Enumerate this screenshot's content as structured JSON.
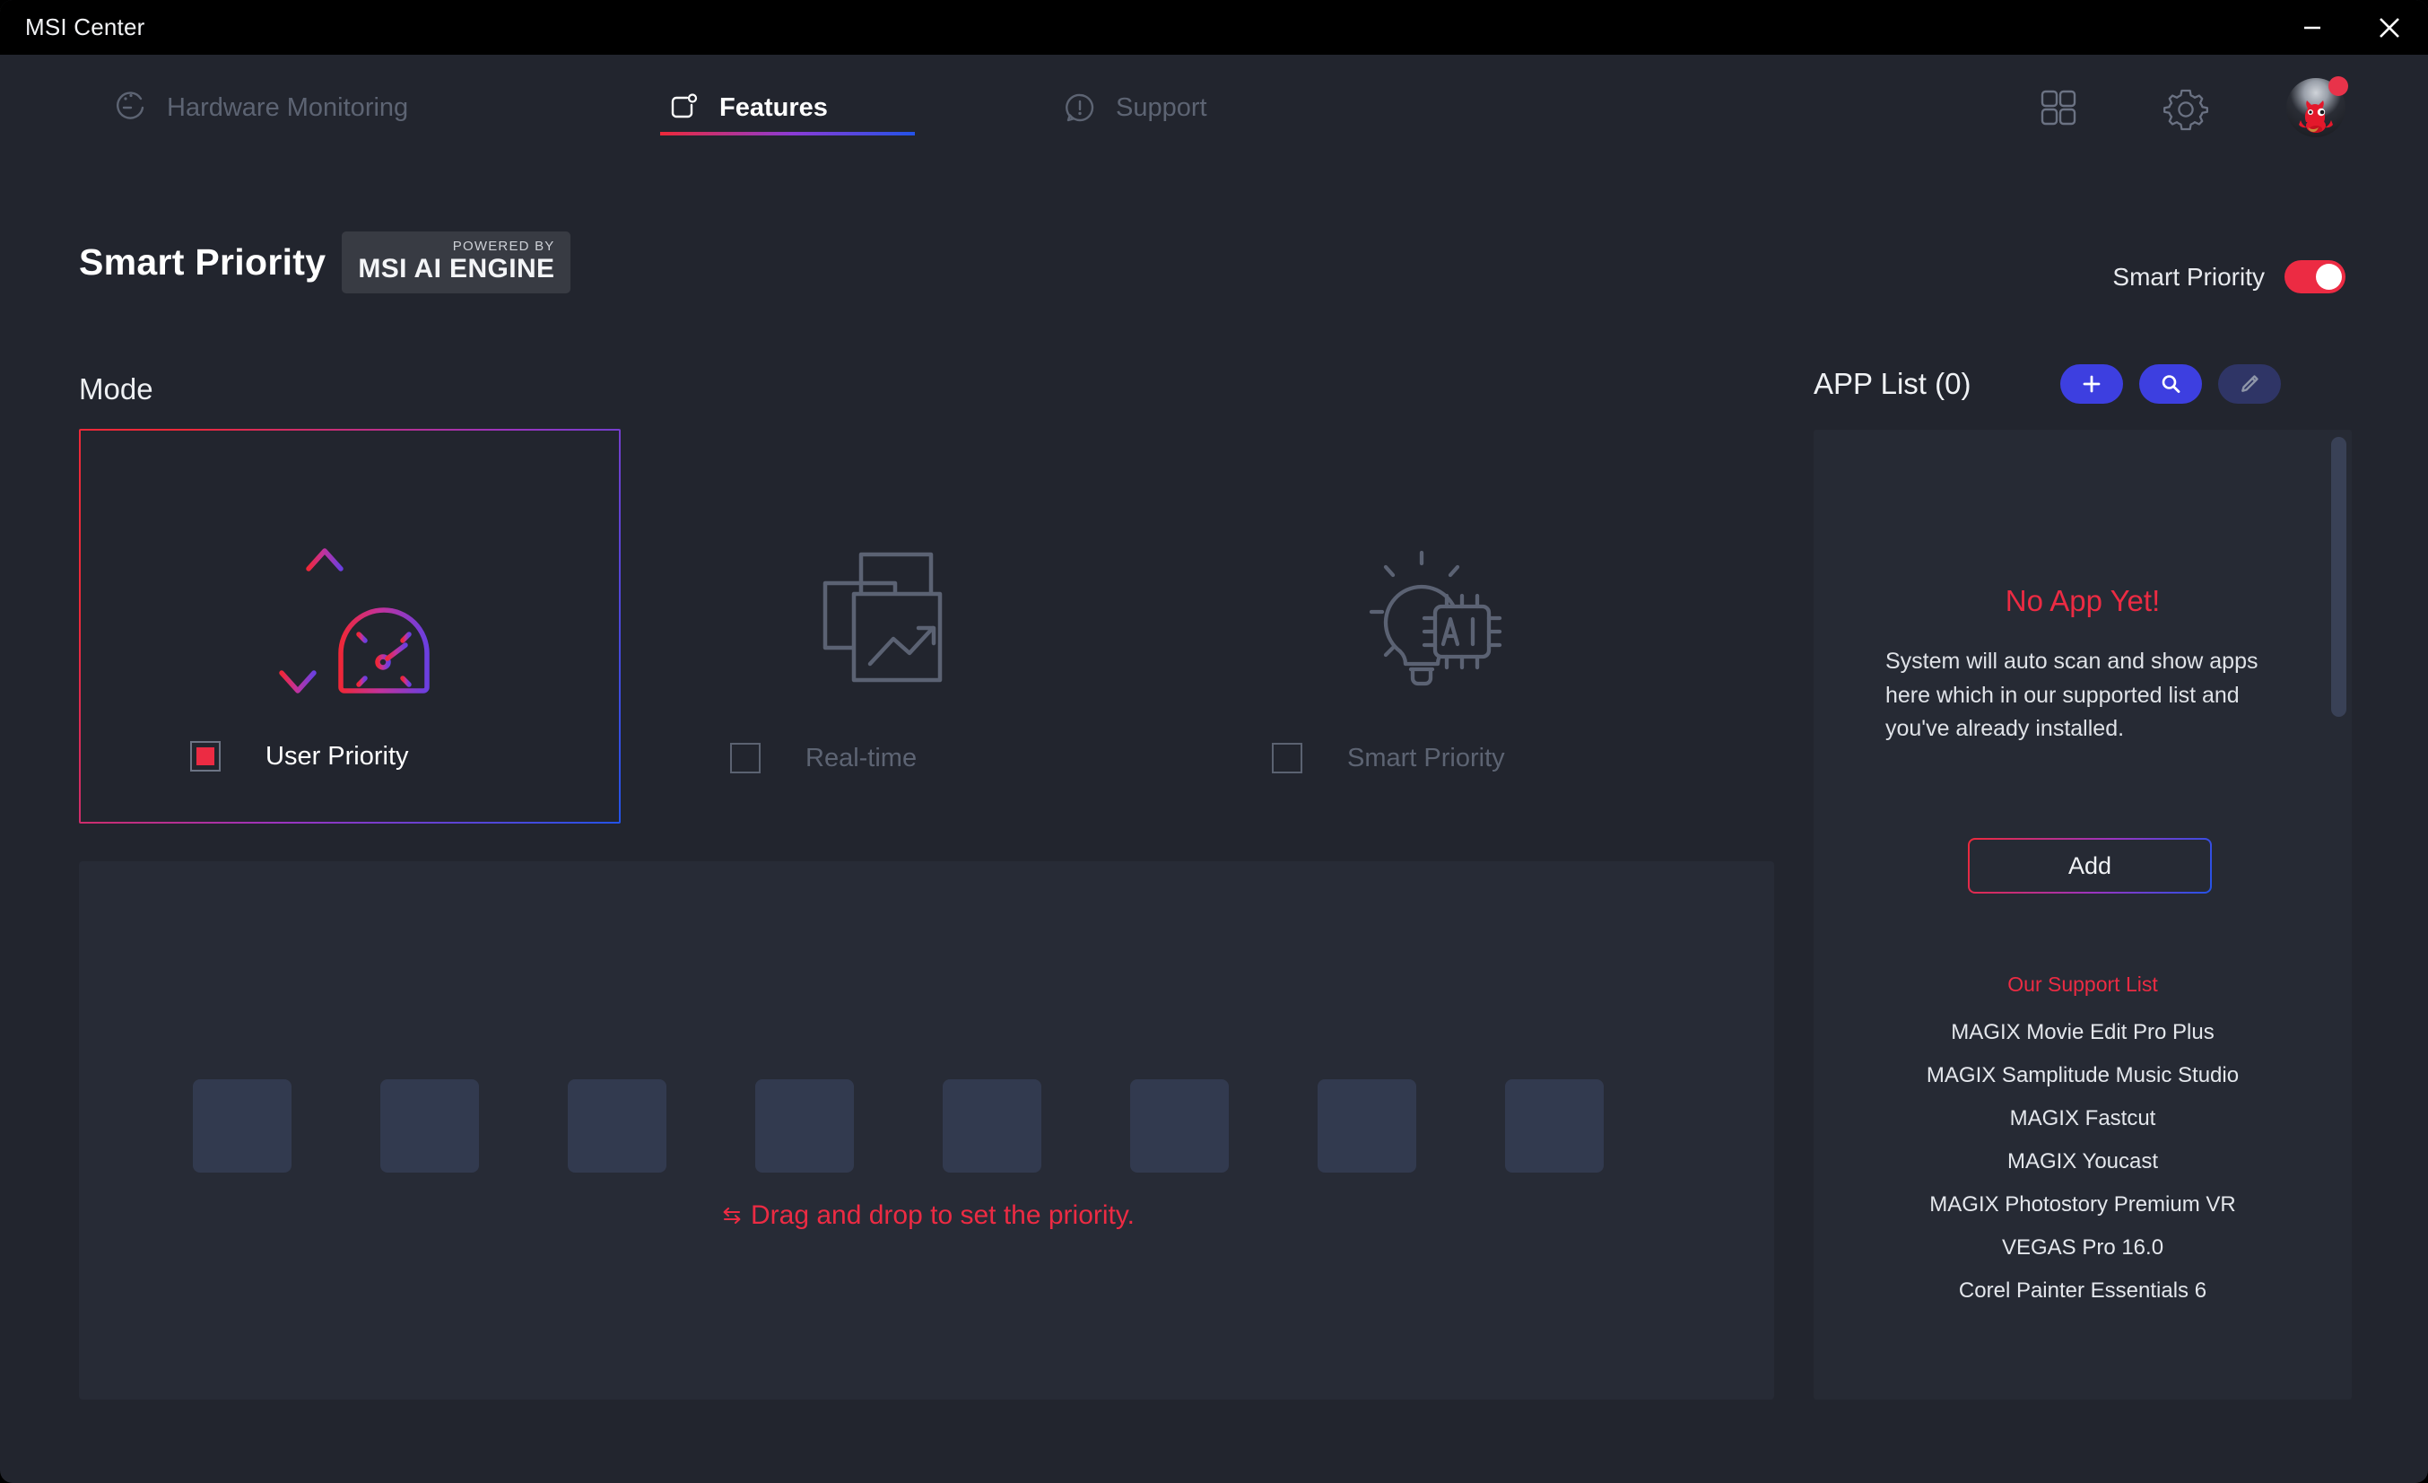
{
  "window": {
    "title": "MSI Center",
    "controls": [
      {
        "name": "minimize",
        "glyph": "minimize-icon"
      },
      {
        "name": "close",
        "glyph": "close-icon"
      }
    ]
  },
  "nav": {
    "tabs": [
      {
        "label": "Hardware Monitoring",
        "icon": "gauge-icon",
        "active": false
      },
      {
        "label": "Features",
        "icon": "feature-square-icon",
        "active": true
      },
      {
        "label": "Support",
        "icon": "exclamation-bubble-icon",
        "active": false
      }
    ],
    "right_icons": [
      {
        "name": "apps-grid-icon"
      },
      {
        "name": "gear-icon"
      },
      {
        "name": "avatar"
      }
    ],
    "active_underline_colors": {
      "start": "#ed2939",
      "end": "#2353e8"
    }
  },
  "header": {
    "title": "Smart Priority",
    "badge_small": "POWERED BY",
    "badge_main": "MSI AI ENGINE",
    "toggle_label": "Smart Priority",
    "toggle_on": true,
    "toggle_color": "#ec2b43"
  },
  "mode": {
    "section_label": "Mode",
    "cards": [
      {
        "label": "User Priority",
        "icon": "priority-gauge-icon",
        "selected": true
      },
      {
        "label": "Real-time",
        "icon": "stacked-windows-chart-icon",
        "selected": false
      },
      {
        "label": "Smart Priority",
        "icon": "lightbulb-ai-chip-icon",
        "selected": false
      }
    ]
  },
  "dropzone": {
    "slot_count": 8,
    "hint_text": "Drag and drop to set the priority.",
    "hint_icon": "swap-arrows-icon",
    "hint_color": "#ec2b43"
  },
  "app_list": {
    "title": "APP List (0)",
    "count": 0,
    "buttons": [
      {
        "name": "add",
        "icon": "plus-icon",
        "enabled": true
      },
      {
        "name": "search",
        "icon": "search-icon",
        "enabled": true
      },
      {
        "name": "edit",
        "icon": "pencil-icon",
        "enabled": false
      }
    ],
    "empty_title": "No App Yet!",
    "empty_desc": "System will auto scan and show apps here which in our supported list and you've already installed.",
    "add_button_label": "Add",
    "support_title": "Our Support List",
    "support_items": [
      "MAGIX Movie Edit Pro Plus",
      "MAGIX Samplitude Music Studio",
      "MAGIX Fastcut",
      "MAGIX Youcast",
      "MAGIX Photostory Premium VR",
      "VEGAS Pro 16.0",
      "Corel Painter Essentials 6"
    ]
  }
}
